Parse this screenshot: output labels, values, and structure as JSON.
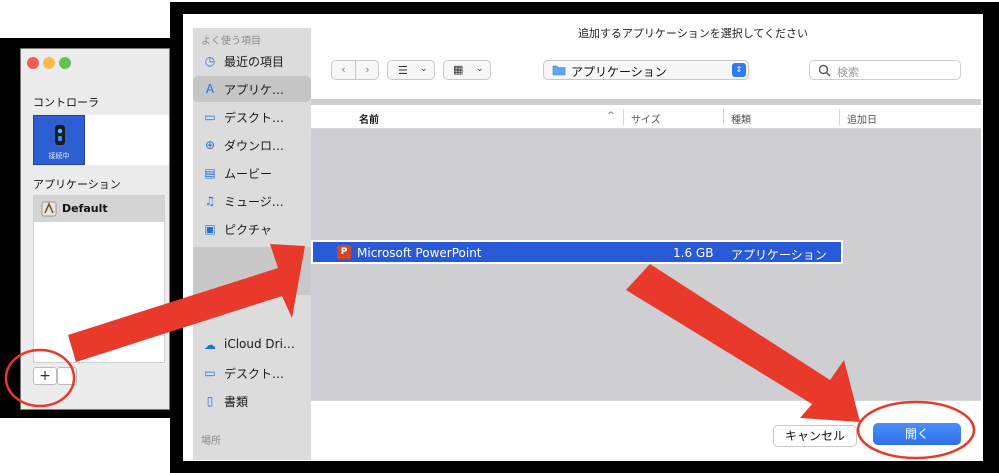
{
  "background_window": {
    "controller_section_label": "コントローラ",
    "controller_status": "接続中",
    "applications_section_label": "アプリケーション",
    "app_list": [
      {
        "label": "Default"
      }
    ],
    "add_button_label": "+"
  },
  "dialog": {
    "title": "追加するアプリケーションを選択してください",
    "sidebar": {
      "favorites_header": "よく使う項目",
      "favorites": [
        {
          "label": "最近の項目",
          "icon": "clock-icon"
        },
        {
          "label": "アプリケ…",
          "icon": "applications-icon",
          "selected": true
        },
        {
          "label": "デスクト…",
          "icon": "desktop-icon"
        },
        {
          "label": "ダウンロ…",
          "icon": "downloads-icon"
        },
        {
          "label": "ムービー",
          "icon": "movies-icon"
        },
        {
          "label": "ミュージ…",
          "icon": "music-icon"
        },
        {
          "label": "ピクチャ",
          "icon": "pictures-icon"
        }
      ],
      "icloud": [
        {
          "label": "iCloud Dri…",
          "icon": "cloud-icon"
        },
        {
          "label": "デスクト…",
          "icon": "desktop-icon"
        },
        {
          "label": "書類",
          "icon": "document-icon"
        }
      ],
      "locations_header": "場所"
    },
    "toolbar": {
      "folder_label": "アプリケーション",
      "search_placeholder": "検索"
    },
    "columns": [
      "名前",
      "サイズ",
      "種類",
      "追加日"
    ],
    "rows": [
      {
        "name": "Microsoft PowerPoint",
        "size": "1.6 GB",
        "kind": "アプリケーション",
        "selected": true
      }
    ],
    "cancel_label": "キャンセル",
    "open_label": "開く"
  },
  "colors": {
    "accent": "#2859d6",
    "annotation": "#e8392b"
  }
}
